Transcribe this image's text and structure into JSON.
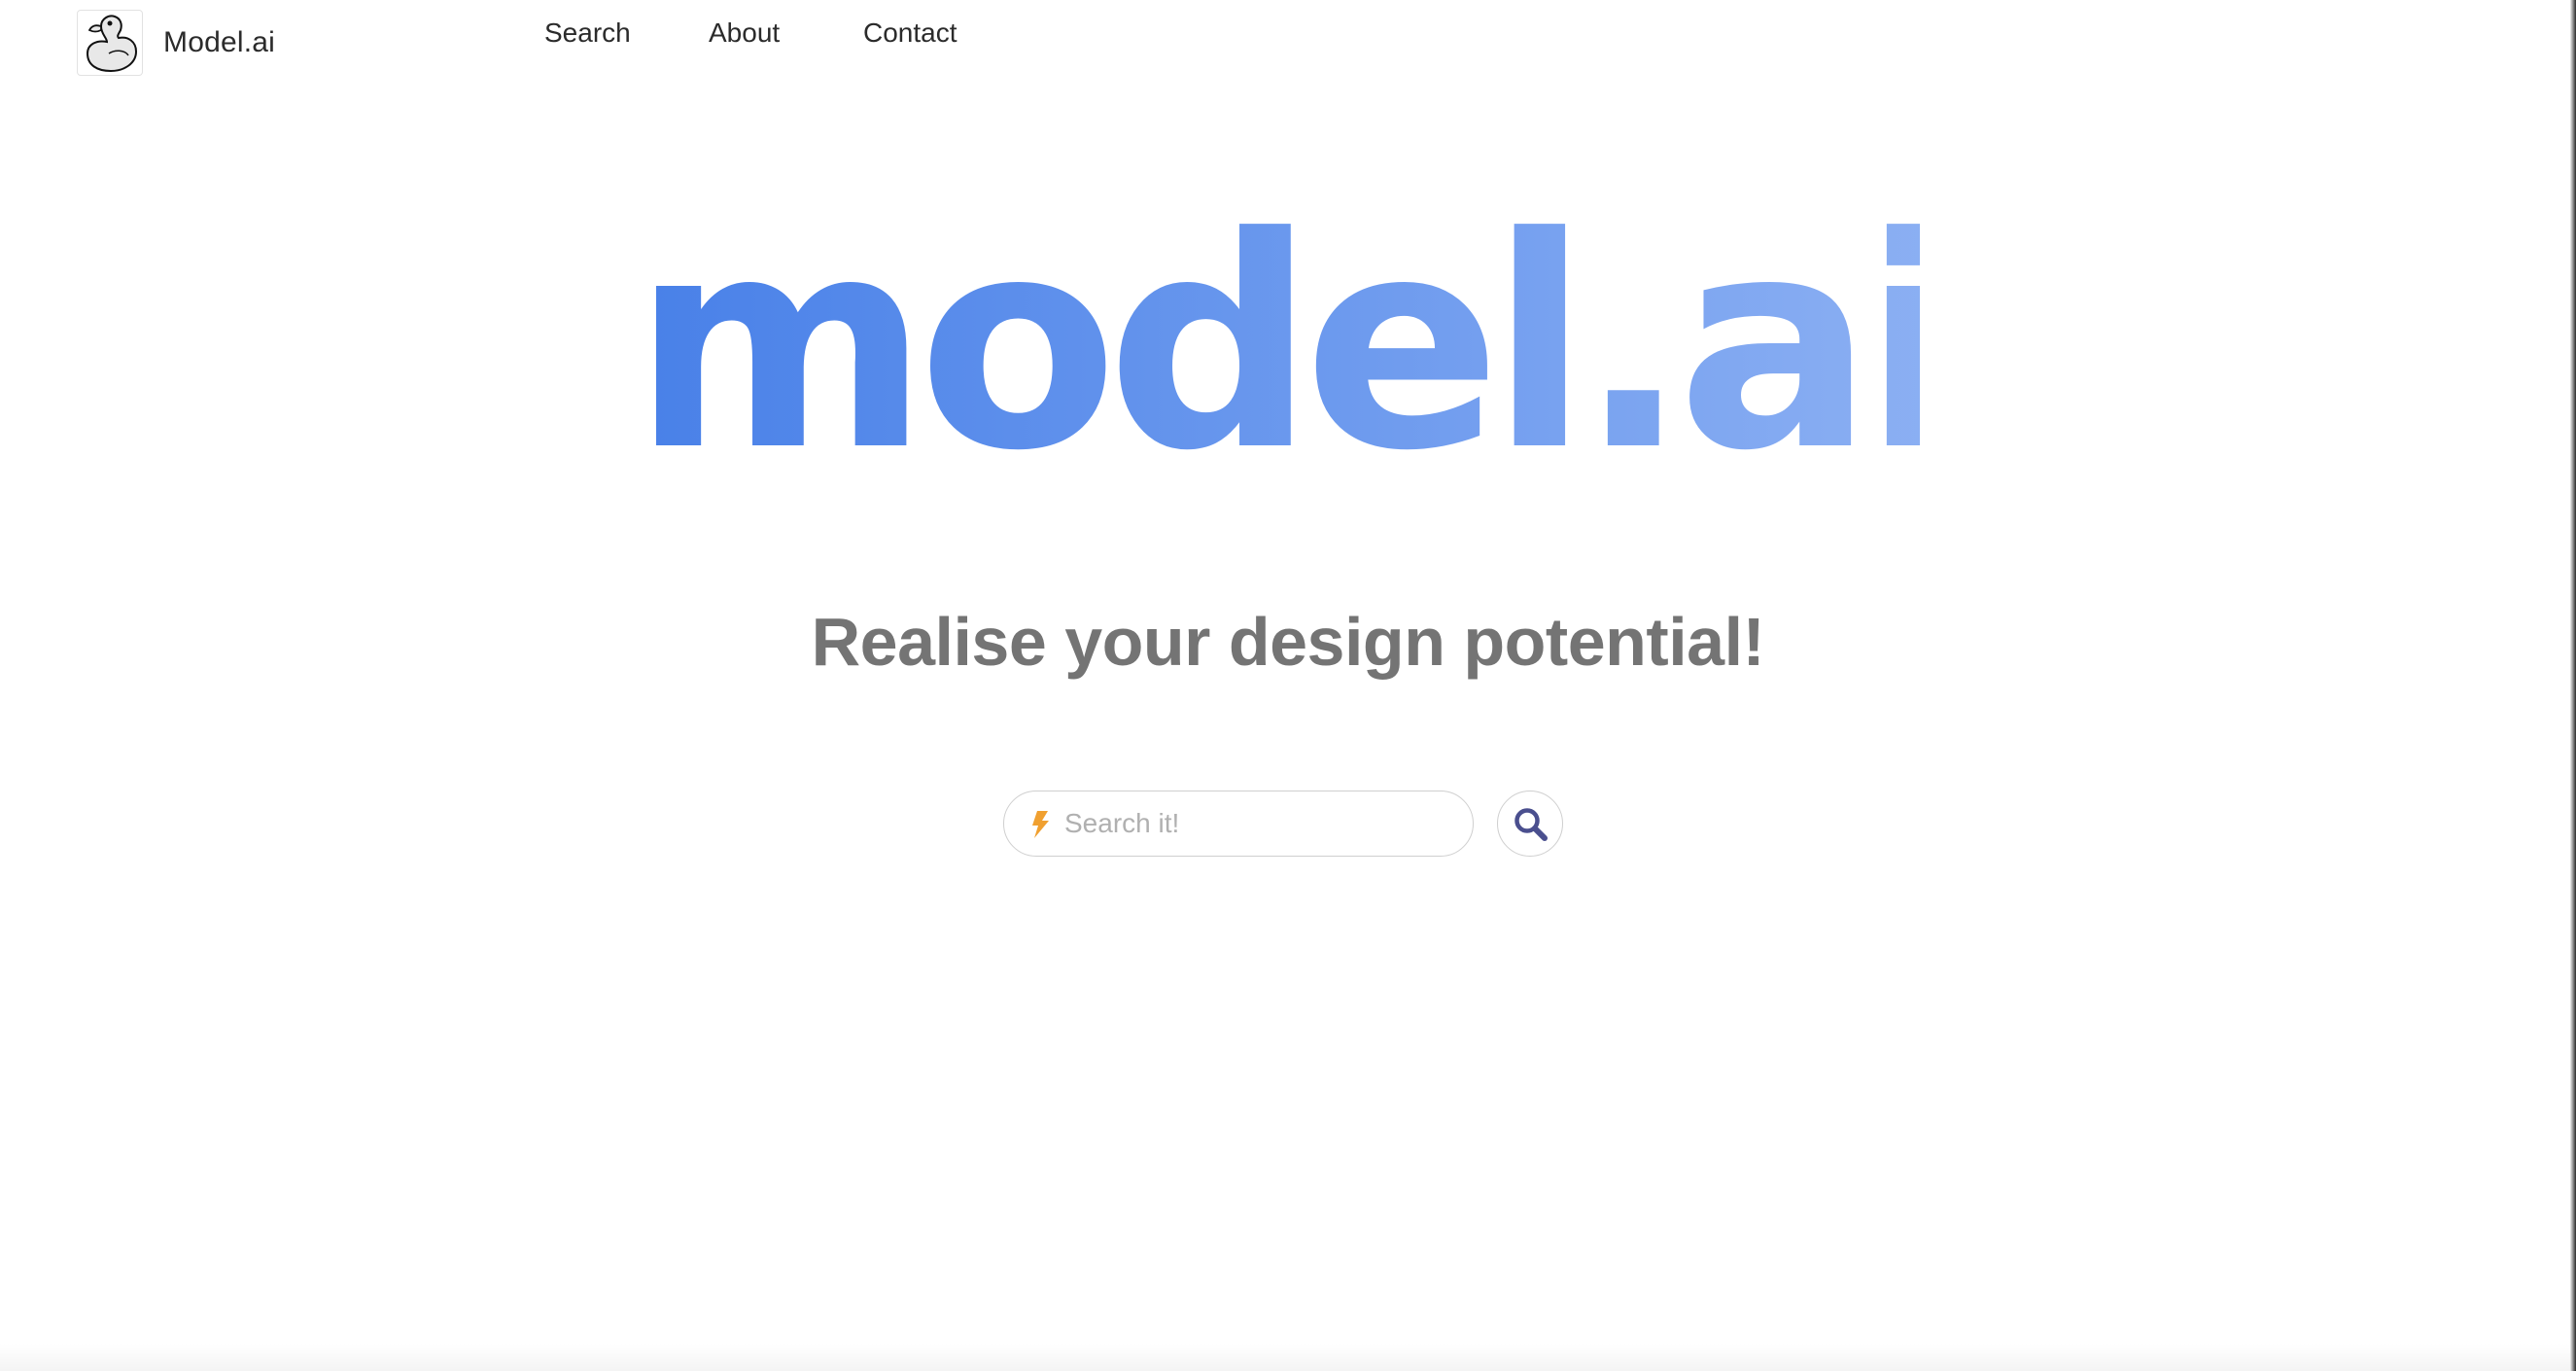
{
  "header": {
    "brand_name": "Model.ai",
    "logo_icon": "duck-icon",
    "nav": [
      {
        "label": "Search"
      },
      {
        "label": "About"
      },
      {
        "label": "Contact"
      }
    ]
  },
  "hero": {
    "title": "model.ai",
    "title_gradient": [
      "#4880e8",
      "#8cb0f3"
    ],
    "tagline": "Realise your design potential!"
  },
  "search": {
    "placeholder": "Search it!",
    "value": "",
    "left_icon": "lightning-bolt-icon",
    "left_icon_color": "#f0a030",
    "button_icon": "magnifier-icon",
    "button_icon_color": "#4a4f8e"
  }
}
